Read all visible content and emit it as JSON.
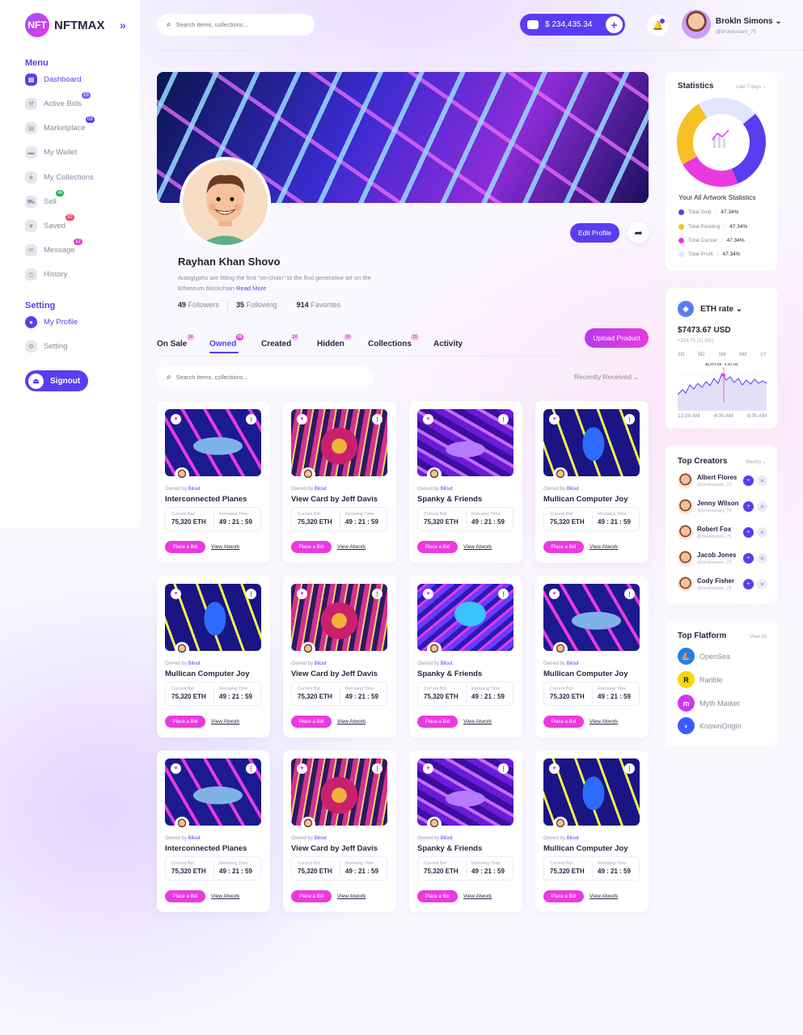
{
  "app": {
    "logo_mark": "NFT",
    "logo_text": "NFTMAX"
  },
  "sidebar": {
    "menu_title": "Menu",
    "items": [
      {
        "label": "Dashboard",
        "icon": "dashboard-icon",
        "active": true,
        "badge": ""
      },
      {
        "label": "Active Bids",
        "icon": "hammer-icon",
        "badge": "19"
      },
      {
        "label": "Marketplace",
        "icon": "store-icon",
        "badge": "09"
      },
      {
        "label": "My Wallet",
        "icon": "wallet-icon",
        "badge": ""
      },
      {
        "label": "My Collections",
        "icon": "star-icon",
        "badge": ""
      },
      {
        "label": "Sell",
        "icon": "cart-icon",
        "badge": "4k"
      },
      {
        "label": "Saved",
        "icon": "heart-icon",
        "badge": "32"
      },
      {
        "label": "Message",
        "icon": "mail-icon",
        "badge": "12"
      },
      {
        "label": "History",
        "icon": "history-icon",
        "badge": ""
      }
    ],
    "setting_title": "Setting",
    "setting_items": [
      {
        "label": "My Profile",
        "icon": "user-icon",
        "active": true
      },
      {
        "label": "Setting",
        "icon": "gear-icon"
      }
    ],
    "signout_label": "Signout"
  },
  "topbar": {
    "search_placeholder": "Search items, collections...",
    "wallet_amount": "$ 234,435.34",
    "user_name": "Brokln Simons",
    "user_handle": "@broklinsiam_75"
  },
  "profile": {
    "name": "Rayhan Khan Shovo",
    "bio": "Autoglyphs are fitting the first \"on-chain\" to the find generative art on the Ethereum blockchain",
    "read_more": "Read More",
    "followers_count": "49",
    "followers_label": "Followers",
    "following_count": "35",
    "following_label": "Following",
    "favorites_count": "914",
    "favorites_label": "Favorites",
    "edit_label": "Edit Profile"
  },
  "tabs": [
    {
      "label": "On Sale",
      "count": "14"
    },
    {
      "label": "Owned",
      "count": "09",
      "active": true
    },
    {
      "label": "Created",
      "count": "24"
    },
    {
      "label": "Hidden",
      "count": "18"
    },
    {
      "label": "Collections",
      "count": "21"
    },
    {
      "label": "Activity",
      "count": ""
    }
  ],
  "upload_label": "Upload Product",
  "content_search_placeholder": "Search items, collections...",
  "sort_label": "Recently Received",
  "card_labels": {
    "owned_by": "Owned by",
    "owner": "Bilout",
    "current_bid": "Current Bid",
    "remaining": "Remaing Time",
    "place_bid": "Place a Bid",
    "view_artwork": "View Atwork"
  },
  "cards": [
    {
      "title": "Interconnected Planes",
      "art": "shark",
      "bid": "75,320 ETH",
      "time": "49 : 21 : 59"
    },
    {
      "title": "View Card by Jeff Davis",
      "art": "tiger",
      "bid": "75,320 ETH",
      "time": "49 : 21 : 59"
    },
    {
      "title": "Spanky & Friends",
      "art": "leopard",
      "bid": "75,320 ETH",
      "time": "49 : 21 : 59"
    },
    {
      "title": "Mullican Computer Joy",
      "art": "parrot",
      "bid": "75,320 ETH",
      "time": "49 : 21 : 59"
    },
    {
      "title": "Mullican Computer Joy",
      "art": "parrot",
      "bid": "75,320 ETH",
      "time": "49 : 21 : 59"
    },
    {
      "title": "View Card by Jeff Davis",
      "art": "tiger",
      "bid": "75,320 ETH",
      "time": "49 : 21 : 59"
    },
    {
      "title": "Spanky & Friends",
      "art": "wolf",
      "bid": "75,320 ETH",
      "time": "49 : 21 : 59"
    },
    {
      "title": "Mullican Computer Joy",
      "art": "shark",
      "bid": "75,320 ETH",
      "time": "49 : 21 : 59"
    },
    {
      "title": "Interconnected Planes",
      "art": "shark",
      "bid": "75,320 ETH",
      "time": "49 : 21 : 59"
    },
    {
      "title": "View Card by Jeff Davis",
      "art": "tiger",
      "bid": "75,320 ETH",
      "time": "49 : 21 : 59"
    },
    {
      "title": "Spanky & Friends",
      "art": "leopard",
      "bid": "75,320 ETH",
      "time": "49 : 21 : 59"
    },
    {
      "title": "Mullican Computer Joy",
      "art": "parrot",
      "bid": "75,320 ETH",
      "time": "49 : 21 : 59"
    }
  ],
  "statistics": {
    "title": "Statistics",
    "range": "Last 7 days",
    "subtitle": "Your All Artwork Statistics",
    "items": [
      {
        "label": "Total Sold",
        "value": "47.34%",
        "color": "#5b3cf0"
      },
      {
        "label": "Total Panding",
        "value": "47.34%",
        "color": "#f5c125"
      },
      {
        "label": "Total Cancel",
        "value": "47.34%",
        "color": "#e93ae0"
      },
      {
        "label": "Total Profit",
        "value": "47.34%",
        "color": "#e3e6ff"
      }
    ]
  },
  "eth": {
    "title": "ETH rate",
    "price": "$7473.67 USD",
    "change": "+324.75 (11.5%)",
    "ranges": [
      "1D",
      "5D",
      "1M",
      "6M",
      "1Y"
    ],
    "peak_label": "$2,874.09 · 4:40 AM",
    "times": [
      "12:00 AM",
      "4:00 AM",
      "8:00 AM"
    ]
  },
  "creators": {
    "title": "Top Creators",
    "range": "Weekly",
    "list": [
      {
        "name": "Albert Flores",
        "handle": "@broklinsiam_75"
      },
      {
        "name": "Jenny Wilson",
        "handle": "@broklinsiam_75"
      },
      {
        "name": "Robert Fox",
        "handle": "@broklinsiam_75"
      },
      {
        "name": "Jacob Jones",
        "handle": "@broklinsiam_75"
      },
      {
        "name": "Cody Fisher",
        "handle": "@broklinsiam_75"
      }
    ]
  },
  "platforms": {
    "title": "Top Flatform",
    "view_all": "View All",
    "list": [
      {
        "name": "OpenSea",
        "mark": "⛵",
        "color": "#2081e2"
      },
      {
        "name": "Rarible",
        "mark": "R",
        "color": "#f5d90a"
      },
      {
        "name": "Myth Market",
        "mark": "m",
        "color": "#c93af0"
      },
      {
        "name": "KnownOrigin",
        "mark": "◗",
        "color": "#3d5afe"
      }
    ]
  }
}
